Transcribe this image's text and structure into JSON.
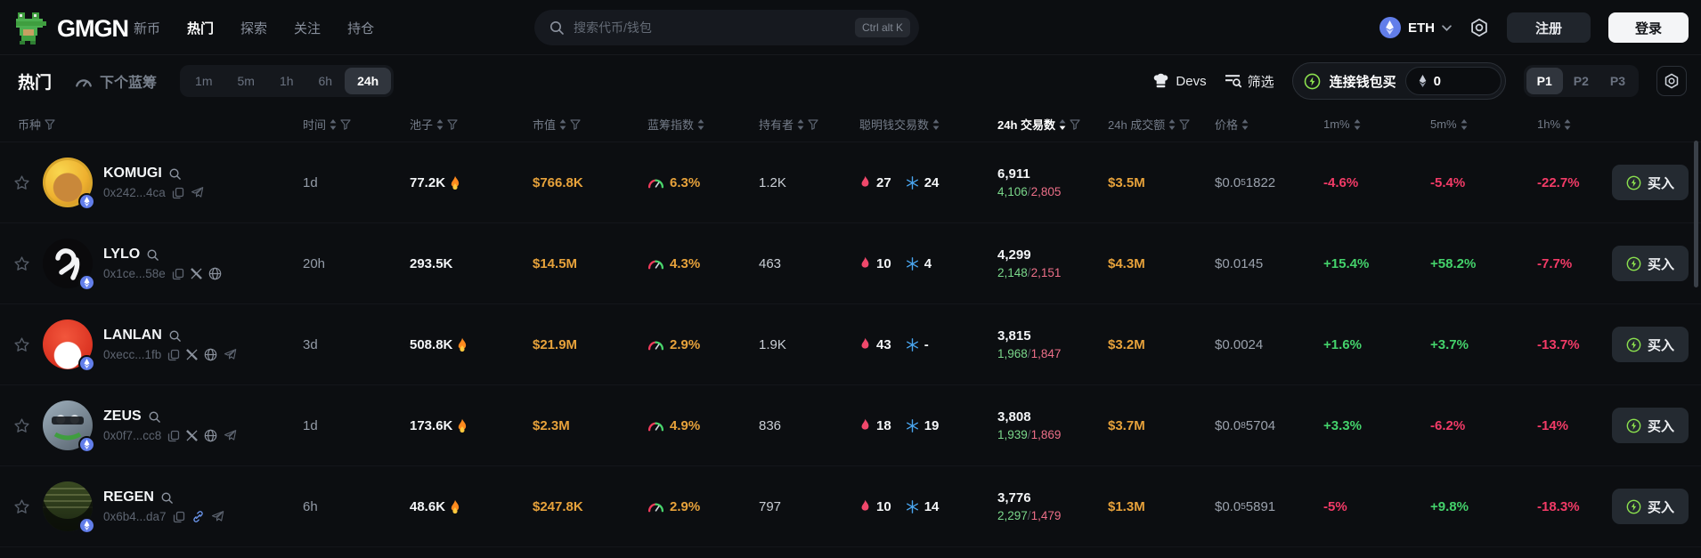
{
  "topbar": {
    "logo": "GMGN",
    "nav_items": [
      {
        "label": "新币"
      },
      {
        "label": "热门"
      },
      {
        "label": "探索"
      },
      {
        "label": "关注"
      },
      {
        "label": "持仓"
      }
    ],
    "search_placeholder": "搜索代币/钱包",
    "search_shortcut": "Ctrl alt K",
    "chain_selector": "ETH",
    "register_label": "注册",
    "login_label": "登录"
  },
  "toolbar": {
    "title": "热门",
    "next_bluechip_label": "下个蓝筹",
    "timeframes": [
      "1m",
      "5m",
      "1h",
      "6h",
      "24h"
    ],
    "active_timeframe": "24h",
    "devs_label": "Devs",
    "filter_label": "筛选",
    "connect_buy_label": "连接钱包买",
    "buy_amount": "0",
    "presets": [
      "P1",
      "P2",
      "P3"
    ],
    "active_preset": "P1"
  },
  "table": {
    "headers": {
      "token": "币种",
      "age": "时间",
      "liquidity": "池子",
      "market_cap": "市值",
      "bluechip_index": "蓝筹指数",
      "holders": "持有者",
      "smart_money_txs": "聪明钱交易数",
      "txs_24h": "24h 交易数",
      "volume_24h": "24h 成交额",
      "price": "价格",
      "change_1m": "1m%",
      "change_5m": "5m%",
      "change_1h": "1h%"
    },
    "separator": "/",
    "buy_label": "买入"
  },
  "colors": {
    "up": "#44d26b",
    "down": "#f23b67",
    "yellow": "#e7a23b",
    "accent_green": "#8be04e",
    "eth_blue": "#627eea"
  },
  "rows": [
    {
      "name": "KOMUGI",
      "address": "0x242...4ca",
      "time": "1d",
      "pool": "77.2K",
      "pool_flame": true,
      "mcap": "$766.8K",
      "bluechip": "6.3%",
      "holders": "1.2K",
      "smart_buys": "27",
      "smart_sells": "24",
      "tx_total": "6,911",
      "tx_buys": "4,106",
      "tx_sells": "2,805",
      "volume": "$3.5M",
      "price_prefix": "$0.0",
      "price_sub": "5",
      "price_rest": "1822",
      "chg_1m": "-4.6%",
      "chg_1m_color": "#f23b67",
      "chg_5m": "-5.4%",
      "chg_5m_color": "#f23b67",
      "chg_1h": "-22.7%",
      "chg_1h_color": "#f23b67",
      "links": {
        "x": false,
        "web": false,
        "chain": false,
        "tg": true
      }
    },
    {
      "name": "LYLO",
      "address": "0x1ce...58e",
      "time": "20h",
      "pool": "293.5K",
      "pool_flame": false,
      "mcap": "$14.5M",
      "bluechip": "4.3%",
      "holders": "463",
      "smart_buys": "10",
      "smart_sells": "4",
      "tx_total": "4,299",
      "tx_buys": "2,148",
      "tx_sells": "2,151",
      "volume": "$4.3M",
      "price_prefix": "$0.0145",
      "price_sub": "",
      "price_rest": "",
      "chg_1m": "+15.4%",
      "chg_1m_color": "#44d26b",
      "chg_5m": "+58.2%",
      "chg_5m_color": "#44d26b",
      "chg_1h": "-7.7%",
      "chg_1h_color": "#f23b67",
      "links": {
        "x": true,
        "web": true,
        "chain": false,
        "tg": false
      }
    },
    {
      "name": "LANLAN",
      "address": "0xecc...1fb",
      "time": "3d",
      "pool": "508.8K",
      "pool_flame": true,
      "mcap": "$21.9M",
      "bluechip": "2.9%",
      "holders": "1.9K",
      "smart_buys": "43",
      "smart_sells": "-",
      "tx_total": "3,815",
      "tx_buys": "1,968",
      "tx_sells": "1,847",
      "volume": "$3.2M",
      "price_prefix": "$0.0024",
      "price_sub": "",
      "price_rest": "",
      "chg_1m": "+1.6%",
      "chg_1m_color": "#44d26b",
      "chg_5m": "+3.7%",
      "chg_5m_color": "#44d26b",
      "chg_1h": "-13.7%",
      "chg_1h_color": "#f23b67",
      "links": {
        "x": true,
        "web": true,
        "chain": false,
        "tg": true
      }
    },
    {
      "name": "ZEUS",
      "address": "0x0f7...cc8",
      "time": "1d",
      "pool": "173.6K",
      "pool_flame": true,
      "mcap": "$2.3M",
      "bluechip": "4.9%",
      "holders": "836",
      "smart_buys": "18",
      "smart_sells": "19",
      "tx_total": "3,808",
      "tx_buys": "1,939",
      "tx_sells": "1,869",
      "volume": "$3.7M",
      "price_prefix": "$0.0",
      "price_sub": "8",
      "price_rest": "5704",
      "chg_1m": "+3.3%",
      "chg_1m_color": "#44d26b",
      "chg_5m": "-6.2%",
      "chg_5m_color": "#f23b67",
      "chg_1h": "-14%",
      "chg_1h_color": "#f23b67",
      "links": {
        "x": true,
        "web": true,
        "chain": false,
        "tg": true
      }
    },
    {
      "name": "REGEN",
      "address": "0x6b4...da7",
      "time": "6h",
      "pool": "48.6K",
      "pool_flame": true,
      "mcap": "$247.8K",
      "bluechip": "2.9%",
      "holders": "797",
      "smart_buys": "10",
      "smart_sells": "14",
      "tx_total": "3,776",
      "tx_buys": "2,297",
      "tx_sells": "1,479",
      "volume": "$1.3M",
      "price_prefix": "$0.0",
      "price_sub": "5",
      "price_rest": "5891",
      "chg_1m": "-5%",
      "chg_1m_color": "#f23b67",
      "chg_5m": "+9.8%",
      "chg_5m_color": "#44d26b",
      "chg_1h": "-18.3%",
      "chg_1h_color": "#f23b67",
      "links": {
        "x": false,
        "web": false,
        "chain": true,
        "tg": true
      }
    }
  ]
}
